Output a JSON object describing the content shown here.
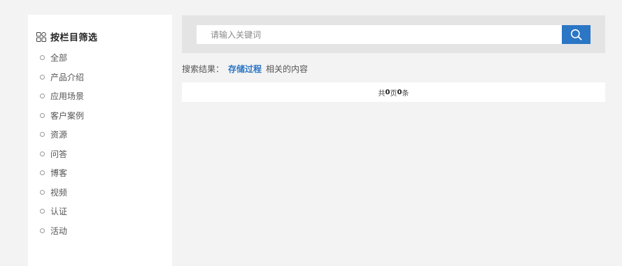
{
  "sidebar": {
    "title": "按栏目筛选",
    "icon": "grid-icon",
    "items": [
      {
        "label": "全部"
      },
      {
        "label": "产品介绍"
      },
      {
        "label": "应用场景"
      },
      {
        "label": "客户案例"
      },
      {
        "label": "资源"
      },
      {
        "label": "问答"
      },
      {
        "label": "博客"
      },
      {
        "label": "视频"
      },
      {
        "label": "认证"
      },
      {
        "label": "活动"
      }
    ]
  },
  "search": {
    "placeholder": "请输入关键词",
    "value": "",
    "button_icon": "search-icon"
  },
  "result": {
    "prefix": "搜索结果：",
    "keyword": "存储过程",
    "suffix": "相关的内容"
  },
  "pagination": {
    "pre": "共",
    "pages": "0",
    "mid": "页",
    "count": "0",
    "post": "条"
  },
  "colors": {
    "accent": "#2b76c5",
    "background": "#f3f3f3",
    "panel": "#e4e4e4"
  }
}
